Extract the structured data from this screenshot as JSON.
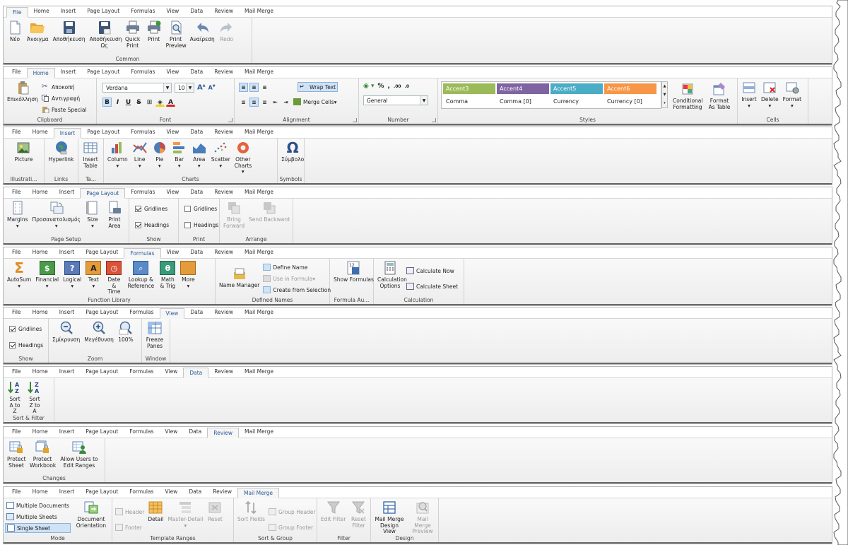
{
  "tabs": [
    "File",
    "Home",
    "Insert",
    "Page Layout",
    "Formulas",
    "View",
    "Data",
    "Review",
    "Mail Merge"
  ],
  "file": {
    "new": "Νέο",
    "open": "Άνοιγμα",
    "save": "Αποθήκευση",
    "saveas": "Αποθήκευση Ως",
    "quick_print": "Quick Print",
    "print": "Print",
    "print_preview": "Print Preview",
    "undo": "Αναίρεση",
    "redo": "Redo",
    "group": "Common"
  },
  "home": {
    "paste": "Επικόλληση",
    "cut": "Αποκοπή",
    "copy": "Αντιγραφή",
    "paste_special": "Paste Special",
    "clipboard": "Clipboard",
    "font_name": "Verdana",
    "font_size": "10",
    "font": "Font",
    "wrap_text": "Wrap Text",
    "merge_cells": "Merge Cells",
    "alignment": "Alignment",
    "number_format": "General",
    "number": "Number",
    "styles": [
      {
        "name": "Accent3",
        "color": "#9bbb59"
      },
      {
        "name": "Accent4",
        "color": "#8064a2"
      },
      {
        "name": "Accent5",
        "color": "#4bacc6"
      },
      {
        "name": "Accent6",
        "color": "#f79646"
      }
    ],
    "styles_row2": [
      "Comma",
      "Comma [0]",
      "Currency",
      "Currency [0]"
    ],
    "styles_label": "Styles",
    "cond_format": "Conditional Formatting",
    "format_table": "Format As Table",
    "insert": "Insert",
    "delete": "Delete",
    "format": "Format",
    "cells": "Cells"
  },
  "insert": {
    "picture": "Picture",
    "illustrations": "Illustrati...",
    "hyperlink": "Hyperlink",
    "links": "Links",
    "insert_table": "Insert Table",
    "tables": "Ta...",
    "column": "Column",
    "line": "Line",
    "pie": "Pie",
    "bar": "Bar",
    "area": "Area",
    "scatter": "Scatter",
    "other_charts": "Other Charts",
    "charts": "Charts",
    "symbol": "Σύμβολο",
    "symbols": "Symbols"
  },
  "page_layout": {
    "margins": "Margins",
    "orientation": "Προσανατολισμός",
    "size": "Size",
    "print_area": "Print Area",
    "page_setup": "Page Setup",
    "gridlines": "Gridlines",
    "headings": "Headings",
    "show": "Show",
    "print": "Print",
    "bring_forward": "Bring Forward",
    "send_backward": "Send Backward",
    "arrange": "Arrange"
  },
  "formulas": {
    "autosum": "AutoSum",
    "financial": "Financial",
    "logical": "Logical",
    "text": "Text",
    "datetime": "Date & Time",
    "lookup": "Lookup & Reference",
    "math": "Math & Trig",
    "more": "More",
    "function_library": "Function Library",
    "name_manager": "Name Manager",
    "define_name": "Define Name",
    "use_in_formula": "Use in Formula",
    "create_from_selection": "Create from Selection",
    "defined_names": "Defined Names",
    "show_formulas": "Show Formulas",
    "formula_auditing": "Formula Au...",
    "calc_options": "Calculation Options",
    "calc_now": "Calculate Now",
    "calc_sheet": "Calculate Sheet",
    "calculation": "Calculation"
  },
  "view": {
    "gridlines": "Gridlines",
    "headings": "Headings",
    "show": "Show",
    "zoom_out": "Σμίκρυνση",
    "zoom_in": "Μεγέθυνση",
    "zoom100": "100%",
    "zoom": "Zoom",
    "freeze": "Freeze Panes",
    "window": "Window"
  },
  "data": {
    "sort_az": "Sort A to Z",
    "sort_za": "Sort Z to A",
    "group": "Sort & Filter"
  },
  "review": {
    "protect_sheet": "Protect Sheet",
    "protect_workbook": "Protect Workbook",
    "allow_users": "Allow Users to Edit Ranges",
    "changes": "Changes"
  },
  "mail_merge": {
    "multiple_documents": "Multiple Documents",
    "multiple_sheets": "Multiple Sheets",
    "single_sheet": "Single Sheet",
    "doc_orientation": "Document Orientation",
    "mode": "Mode",
    "header": "Header",
    "footer": "Footer",
    "detail": "Detail",
    "master_detail": "Master-Detail",
    "reset": "Reset",
    "template_ranges": "Template Ranges",
    "sort_fields": "Sort Fields",
    "group_header": "Group Header",
    "group_footer": "Group Footer",
    "sort_group": "Sort & Group",
    "edit_filter": "Edit Filter",
    "reset_filter": "Reset Filter",
    "filter": "Filter",
    "design_view": "Mail Merge Design View",
    "mm_preview": "Mail Merge Preview",
    "design": "Design"
  }
}
